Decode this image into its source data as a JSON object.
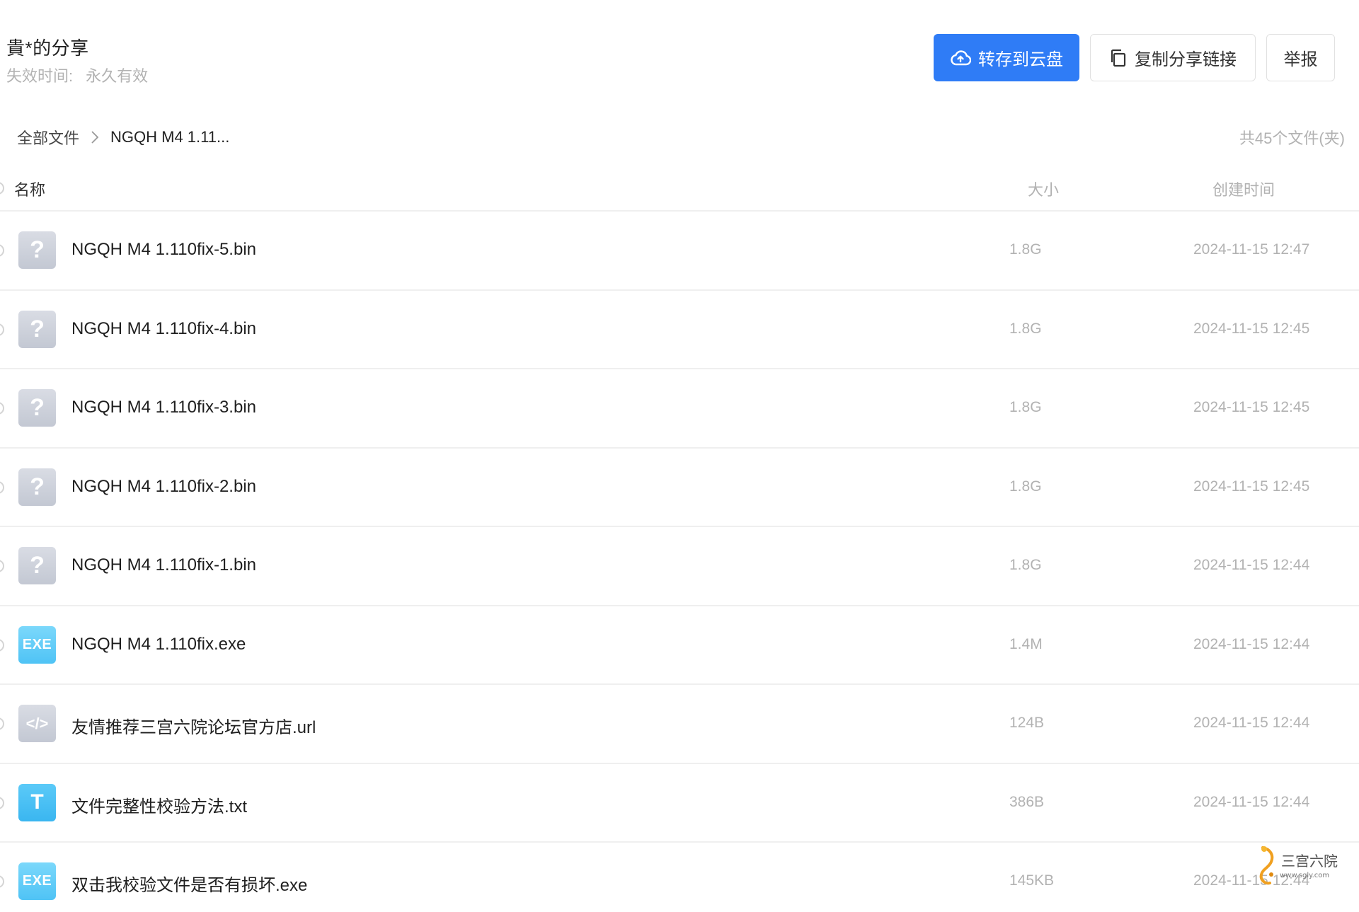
{
  "header": {
    "title": "貴*的分享",
    "expiry_label": "失效时间:",
    "expiry_value": "永久有效"
  },
  "actions": {
    "save_label": "转存到云盘",
    "copy_label": "复制分享链接",
    "report_label": "举报"
  },
  "breadcrumb": {
    "root": "全部文件",
    "current": "NGQH M4 1.11..."
  },
  "file_count": "共45个文件(夹)",
  "table": {
    "columns": {
      "name": "名称",
      "size": "大小",
      "time": "创建时间"
    },
    "rows": [
      {
        "name": "NGQH M4 1.110fix-5.bin",
        "size": "1.8G",
        "time": "2024-11-15 12:47",
        "icon": "unknown-file-icon"
      },
      {
        "name": "NGQH M4 1.110fix-4.bin",
        "size": "1.8G",
        "time": "2024-11-15 12:45",
        "icon": "unknown-file-icon"
      },
      {
        "name": "NGQH M4 1.110fix-3.bin",
        "size": "1.8G",
        "time": "2024-11-15 12:45",
        "icon": "unknown-file-icon"
      },
      {
        "name": "NGQH M4 1.110fix-2.bin",
        "size": "1.8G",
        "time": "2024-11-15 12:45",
        "icon": "unknown-file-icon"
      },
      {
        "name": "NGQH M4 1.110fix-1.bin",
        "size": "1.8G",
        "time": "2024-11-15 12:44",
        "icon": "unknown-file-icon"
      },
      {
        "name": "NGQH M4 1.110fix.exe",
        "size": "1.4M",
        "time": "2024-11-15 12:44",
        "icon": "exe-file-icon",
        "icon_text": "EXE"
      },
      {
        "name": "友情推荐三宫六院论坛官方店.url",
        "size": "124B",
        "time": "2024-11-15 12:44",
        "icon": "url-file-icon",
        "icon_text": "</>"
      },
      {
        "name": "文件完整性校验方法.txt",
        "size": "386B",
        "time": "2024-11-15 12:44",
        "icon": "txt-file-icon",
        "icon_text": "T"
      },
      {
        "name": "双击我校验文件是否有损坏.exe",
        "size": "145KB",
        "time": "2024-11-15 12:44",
        "icon": "exe-file-icon",
        "icon_text": "EXE"
      }
    ]
  },
  "watermark": {
    "text": "三宫六院",
    "url": "www.sgly.com"
  },
  "colors": {
    "primary": "#2f7cf6",
    "muted": "#b2b2b2",
    "divider": "#efefef",
    "exe_icon": "#4fc3f5",
    "unknown_icon": "#c3c8d3"
  }
}
